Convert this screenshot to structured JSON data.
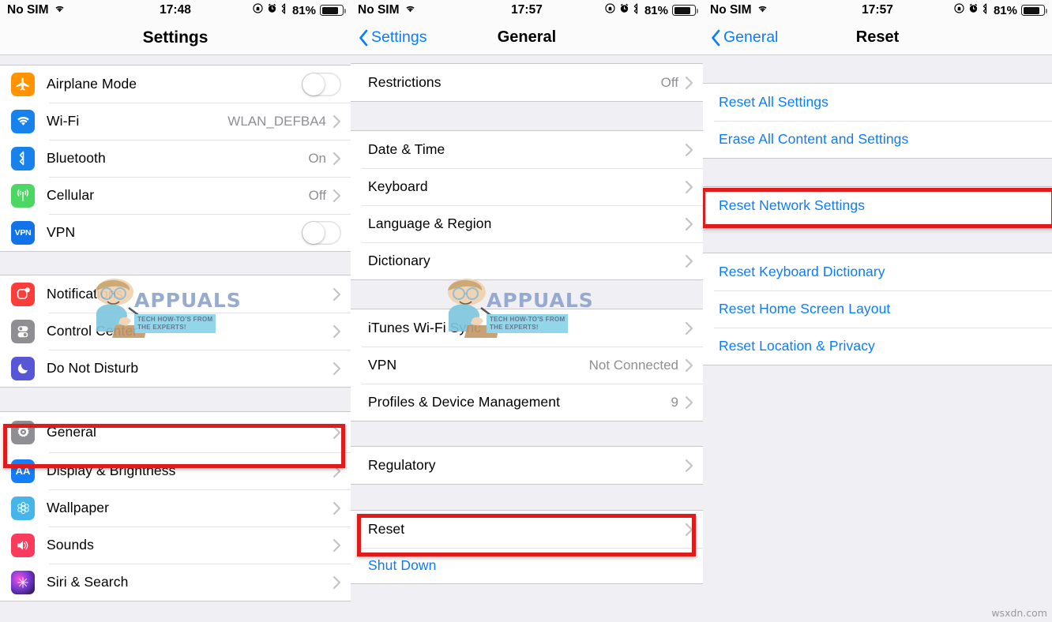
{
  "screens": [
    {
      "id": "settings",
      "status_bar": {
        "carrier": "No SIM",
        "wifi_icon": "wifi-icon",
        "time": "17:48",
        "rotation_lock_icon": "rotation-lock-icon",
        "alarm_icon": "alarm-clock-icon",
        "bluetooth_icon": "bluetooth-icon",
        "battery_percent": "81%",
        "battery_icon": "battery-icon"
      },
      "nav": {
        "title": "Settings",
        "back_label": "",
        "has_back": false
      },
      "groups": [
        {
          "rows": [
            {
              "icon": "airplane-icon",
              "label": "Airplane Mode",
              "accessory": "toggle",
              "toggle_on": false
            },
            {
              "icon": "wifi-icon",
              "label": "Wi-Fi",
              "value": "WLAN_DEFBA4",
              "accessory": "chevron"
            },
            {
              "icon": "bluetooth-icon",
              "label": "Bluetooth",
              "value": "On",
              "accessory": "chevron"
            },
            {
              "icon": "cellular-icon",
              "label": "Cellular",
              "value": "Off",
              "accessory": "chevron"
            },
            {
              "icon": "vpn-icon",
              "label": "VPN",
              "accessory": "toggle",
              "toggle_on": false
            }
          ]
        },
        {
          "rows": [
            {
              "icon": "notifications-icon",
              "label": "Notifications",
              "accessory": "chevron"
            },
            {
              "icon": "control-center-icon",
              "label": "Control Center",
              "accessory": "chevron"
            },
            {
              "icon": "do-not-disturb-icon",
              "label": "Do Not Disturb",
              "accessory": "chevron"
            }
          ]
        },
        {
          "rows": [
            {
              "icon": "gear-icon",
              "label": "General",
              "accessory": "chevron",
              "highlighted": true
            },
            {
              "icon": "display-brightness-icon",
              "label": "Display & Brightness",
              "accessory": "chevron"
            },
            {
              "icon": "wallpaper-icon",
              "label": "Wallpaper",
              "accessory": "chevron"
            },
            {
              "icon": "sounds-icon",
              "label": "Sounds",
              "accessory": "chevron"
            },
            {
              "icon": "siri-icon",
              "label": "Siri & Search",
              "accessory": "chevron"
            }
          ]
        }
      ]
    },
    {
      "id": "general",
      "status_bar": {
        "carrier": "No SIM",
        "wifi_icon": "wifi-icon",
        "time": "17:57",
        "rotation_lock_icon": "rotation-lock-icon",
        "alarm_icon": "alarm-clock-icon",
        "bluetooth_icon": "bluetooth-icon",
        "battery_percent": "81%",
        "battery_icon": "battery-icon"
      },
      "nav": {
        "title": "General",
        "back_label": "Settings",
        "has_back": true
      },
      "groups": [
        {
          "rows": [
            {
              "label": "Restrictions",
              "value": "Off",
              "accessory": "chevron"
            }
          ]
        },
        {
          "rows": [
            {
              "label": "Date & Time",
              "accessory": "chevron"
            },
            {
              "label": "Keyboard",
              "accessory": "chevron"
            },
            {
              "label": "Language & Region",
              "accessory": "chevron"
            },
            {
              "label": "Dictionary",
              "accessory": "chevron"
            }
          ]
        },
        {
          "rows": [
            {
              "label": "iTunes Wi-Fi Sync",
              "accessory": "chevron"
            },
            {
              "label": "VPN",
              "value": "Not Connected",
              "accessory": "chevron"
            },
            {
              "label": "Profiles & Device Management",
              "value": "9",
              "accessory": "chevron"
            }
          ]
        },
        {
          "rows": [
            {
              "label": "Regulatory",
              "accessory": "chevron"
            }
          ]
        },
        {
          "rows": [
            {
              "label": "Reset",
              "accessory": "chevron",
              "highlighted": true
            },
            {
              "label": "Shut Down",
              "accessory": "none",
              "blue": true
            }
          ]
        }
      ]
    },
    {
      "id": "reset",
      "status_bar": {
        "carrier": "No SIM",
        "wifi_icon": "wifi-icon",
        "time": "17:57",
        "rotation_lock_icon": "rotation-lock-icon",
        "alarm_icon": "alarm-clock-icon",
        "bluetooth_icon": "bluetooth-icon",
        "battery_percent": "81%",
        "battery_icon": "battery-icon"
      },
      "nav": {
        "title": "Reset",
        "back_label": "General",
        "has_back": true
      },
      "groups": [
        {
          "rows": [
            {
              "label": "Reset All Settings",
              "accessory": "none",
              "blue": true
            },
            {
              "label": "Erase All Content and Settings",
              "accessory": "none",
              "blue": true
            }
          ]
        },
        {
          "rows": [
            {
              "label": "Reset Network Settings",
              "accessory": "none",
              "blue": true,
              "highlighted": true
            }
          ]
        },
        {
          "rows": [
            {
              "label": "Reset Keyboard Dictionary",
              "accessory": "none",
              "blue": true
            },
            {
              "label": "Reset Home Screen Layout",
              "accessory": "none",
              "blue": true
            },
            {
              "label": "Reset Location & Privacy",
              "accessory": "none",
              "blue": true
            }
          ]
        }
      ]
    }
  ],
  "watermarks": {
    "brand": "APPUALS",
    "tagline_line1": "TECH HOW-TO'S FROM",
    "tagline_line2": "THE EXPERTS!",
    "site": "wsxdn.com"
  },
  "colors": {
    "accent_blue": "#0a7cff",
    "highlight_red": "#e01b1b",
    "group_bg": "#ffffff",
    "page_bg": "#efeff4",
    "value_gray": "#8e8e93"
  }
}
